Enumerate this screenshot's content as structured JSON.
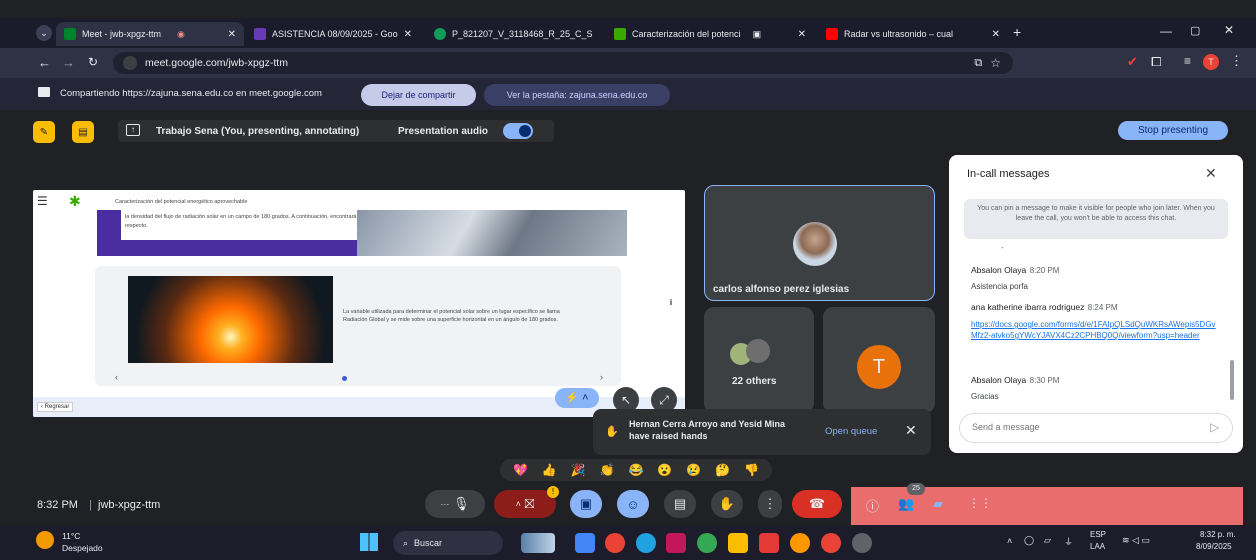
{
  "tabs": [
    {
      "title": "Meet - jwb-xpgz-ttm",
      "color": "#00832d"
    },
    {
      "title": "ASISTENCIA 08/09/2025 - Goo",
      "color": "#673ab7"
    },
    {
      "title": "P_821207_V_3118468_R_25_C_S",
      "color": "#0f9d58"
    },
    {
      "title": "Caracterización del potenci",
      "color": "#39a900"
    },
    {
      "title": "Radar vs ultrasonido – cual",
      "color": "#ff0000"
    }
  ],
  "address": {
    "url": "meet.google.com/jwb-xpgz-ttm",
    "profile_initial": "T"
  },
  "sharebar": {
    "text": "Compartiendo https://zajuna.sena.edu.co en meet.google.com",
    "stop_label": "Dejar de compartir",
    "view_tab_label": "Ver la pestaña: zajuna.sena.edu.co"
  },
  "presenting": {
    "title": "Trabajo Sena (You, presenting, annotating)",
    "audio_label": "Presentation audio",
    "stop_label": "Stop presenting"
  },
  "slide": {
    "header": "Caracterización del potencial energético aprovechable",
    "intro": "la densidad del flujo de radiación solar en un campo de 180 grados. A continuación, encontrará más información al respecto.",
    "body": "La variable utilizada para determinar el potencial solar sobre un lugar específico se llama Radiación Global y se mide sobre una superficie horizontal en un ángulo de 180 grados.",
    "back_label": "‹ Regresar"
  },
  "participants": {
    "main_name": "carlos alfonso perez iglesias",
    "others_label": "22 others",
    "tile_initial": "T"
  },
  "chat": {
    "title": "In-call messages",
    "pin_notice": "You can pin a message to make it visible for people who join later. When you leave the call, you won't be able to access this chat.",
    "messages": [
      {
        "name": "Absalon Olaya",
        "time": "8:20 PM",
        "body": "Asistencia porfa"
      },
      {
        "name": "ana katherine ibarra rodriguez",
        "time": "8:24 PM",
        "body": "https://docs.google.com/forms/d/e/1FAIpQLSdQuWKRsAWepis5DGvMfz2-atvko5gYWcYJAVX4Cz2CPHBQ0Q/viewform?usp=header"
      },
      {
        "name": "Absalon Olaya",
        "time": "8:30 PM",
        "body": "Gracias"
      }
    ],
    "input_placeholder": "Send a message"
  },
  "toast": {
    "text": "Hernan Cerra Arroyo and Yesid Mina have raised hands",
    "action": "Open queue"
  },
  "meeting": {
    "time": "8:32 PM",
    "separator": "|",
    "code": "jwb-xpgz-ttm",
    "people_count": "25"
  },
  "reactions": [
    "💖",
    "👍",
    "🎉",
    "👏",
    "😂",
    "😮",
    "😢",
    "🤔",
    "👎"
  ],
  "taskbar": {
    "temp": "11°C",
    "weather": "Despejado",
    "search": "Buscar",
    "lang": "ESP",
    "lang2": "LAA",
    "clock_time": "8:32 p. m.",
    "clock_date": "8/09/2025"
  }
}
